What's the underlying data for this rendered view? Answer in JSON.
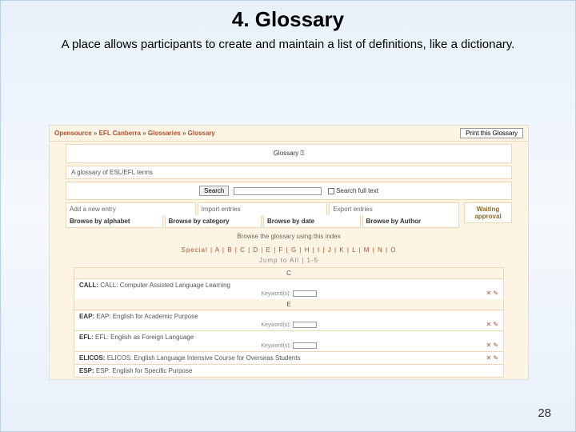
{
  "slide": {
    "title": "4. Glossary",
    "subtitle": "A place allows participants to create and maintain a list of definitions, like a dictionary.",
    "page_number": "28"
  },
  "breadcrumb": {
    "items": [
      "Opensource",
      "EFL Canberra",
      "Glossaries",
      "Glossary"
    ],
    "print_label": "Print this Glossary"
  },
  "glossary": {
    "title": "Glossary",
    "description": "A glossary of ESL/EFL terms",
    "search_button": "Search",
    "search_full_text": "Search full text",
    "tabs_top": [
      "Add a new entry",
      "Import entries",
      "Export entries"
    ],
    "waiting_label": "Waiting approval",
    "tabs_browse": [
      "Browse by alphabet",
      "Browse by category",
      "Browse by date",
      "Browse by Author"
    ],
    "index_hint": "Browse the glossary using this index",
    "alpha": "Special | A | B | C | D | E | F | G | H | I | J | K | L | M | N | O",
    "jump": "Jump to  All | 1-5"
  },
  "sections": [
    {
      "letter": "C",
      "entries": [
        {
          "term": "CALL:",
          "def": "CALL: Computer Assisted Language Learning",
          "meta": "Keyword(s):",
          "icons": "✕ ✎"
        }
      ]
    },
    {
      "letter": "E",
      "entries": [
        {
          "term": "EAP:",
          "def": "EAP: English for Academic Purpose",
          "meta": "Keyword(s):",
          "icons": "✕ ✎"
        },
        {
          "term": "EFL:",
          "def": "EFL: English as Foreign Language",
          "meta": "Keyword(s):",
          "icons": "✕ ✎"
        },
        {
          "term": "ELICOS:",
          "def": "ELICOS: English Language Intensive Course for Overseas Students",
          "meta": "",
          "icons": "✕ ✎"
        },
        {
          "term": "ESP:",
          "def": "ESP: English for Specific Purpose",
          "meta": "",
          "icons": ""
        }
      ]
    }
  ]
}
